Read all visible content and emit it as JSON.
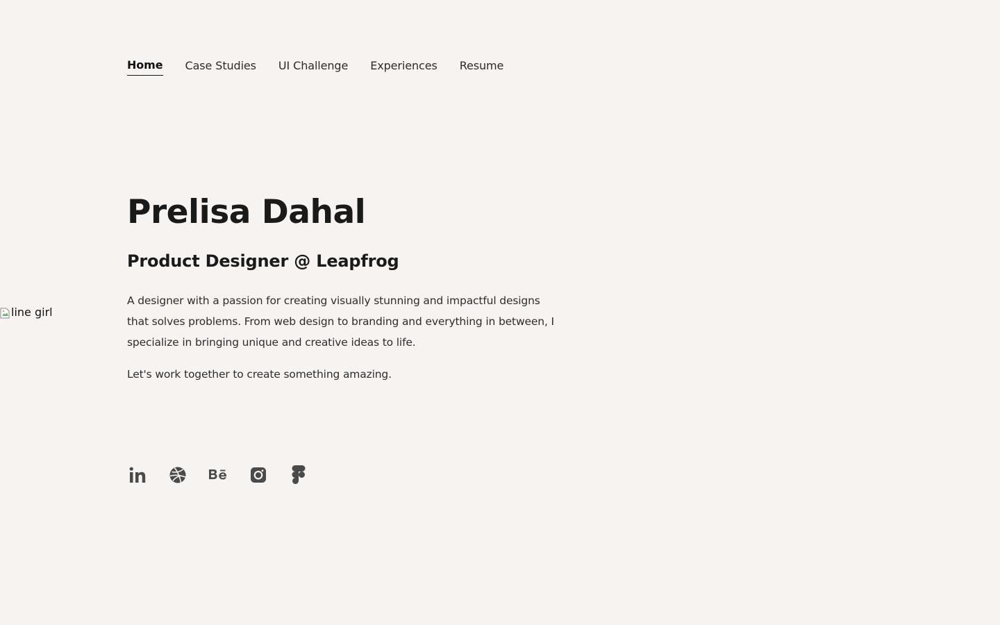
{
  "nav": {
    "items": [
      {
        "label": "Home",
        "active": true
      },
      {
        "label": "Case Studies",
        "active": false
      },
      {
        "label": "UI Challenge",
        "active": false
      },
      {
        "label": "Experiences",
        "active": false
      },
      {
        "label": "Resume",
        "active": false
      }
    ]
  },
  "hero": {
    "name": "Prelisa Dahal",
    "role": "Product Designer @ Leapfrog",
    "bio": "A designer with a passion for creating visually stunning and impactful designs that solves problems. From web design to branding and everything in between, I specialize in bringing unique and creative ideas to life.",
    "cta": "Let's work together to create something amazing."
  },
  "image": {
    "alt": "line girl"
  },
  "socials": [
    {
      "icon": "linkedin-icon"
    },
    {
      "icon": "dribbble-icon"
    },
    {
      "icon": "behance-icon"
    },
    {
      "icon": "instagram-icon"
    },
    {
      "icon": "figma-icon"
    }
  ],
  "colors": {
    "background": "#f7f3f1",
    "text": "#1b1b1b",
    "icon": "#4a4a4a"
  }
}
